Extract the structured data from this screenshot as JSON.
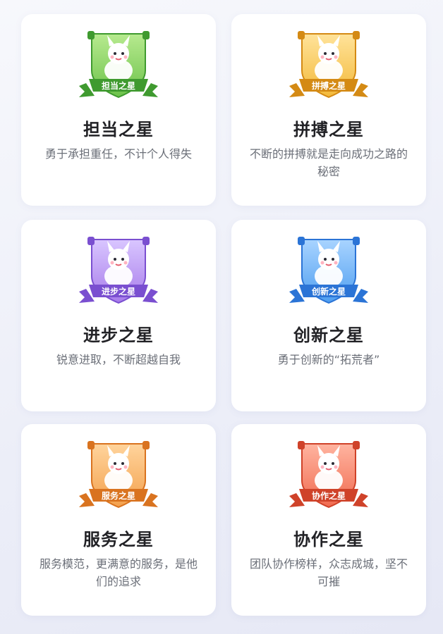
{
  "cards": [
    {
      "badge_label": "担当之星",
      "title": "担当之星",
      "desc": "勇于承担重任，不计个人得失",
      "icon": "shield-badge-icon",
      "color_main": "#6cc24a",
      "color_dark": "#3f9a2f",
      "color_light": "#b7ea8f"
    },
    {
      "badge_label": "拼搏之星",
      "title": "拼搏之星",
      "desc": "不断的拼搏就是走向成功之路的秘密",
      "icon": "shield-badge-icon",
      "color_main": "#f3b93a",
      "color_dark": "#d48a14",
      "color_light": "#ffe39a"
    },
    {
      "badge_label": "进步之星",
      "title": "进步之星",
      "desc": "锐意进取，不断超越自我",
      "icon": "shield-badge-icon",
      "color_main": "#a77bea",
      "color_dark": "#7a4fd0",
      "color_light": "#d9c6ff"
    },
    {
      "badge_label": "创新之星",
      "title": "创新之星",
      "desc": "勇于创新的“拓荒者”",
      "icon": "shield-badge-icon",
      "color_main": "#4f9ef0",
      "color_dark": "#2b74d6",
      "color_light": "#a9d4ff"
    },
    {
      "badge_label": "服务之星",
      "title": "服务之星",
      "desc": "服务模范，更满意的服务，是他们的追求",
      "icon": "shield-badge-icon",
      "color_main": "#f3a04c",
      "color_dark": "#d9731f",
      "color_light": "#ffd49c"
    },
    {
      "badge_label": "协作之星",
      "title": "协作之星",
      "desc": "团队协作榜样，众志成城，坚不可摧",
      "icon": "shield-badge-icon",
      "color_main": "#f06a4f",
      "color_dark": "#cf4229",
      "color_light": "#ffb4a0"
    }
  ]
}
